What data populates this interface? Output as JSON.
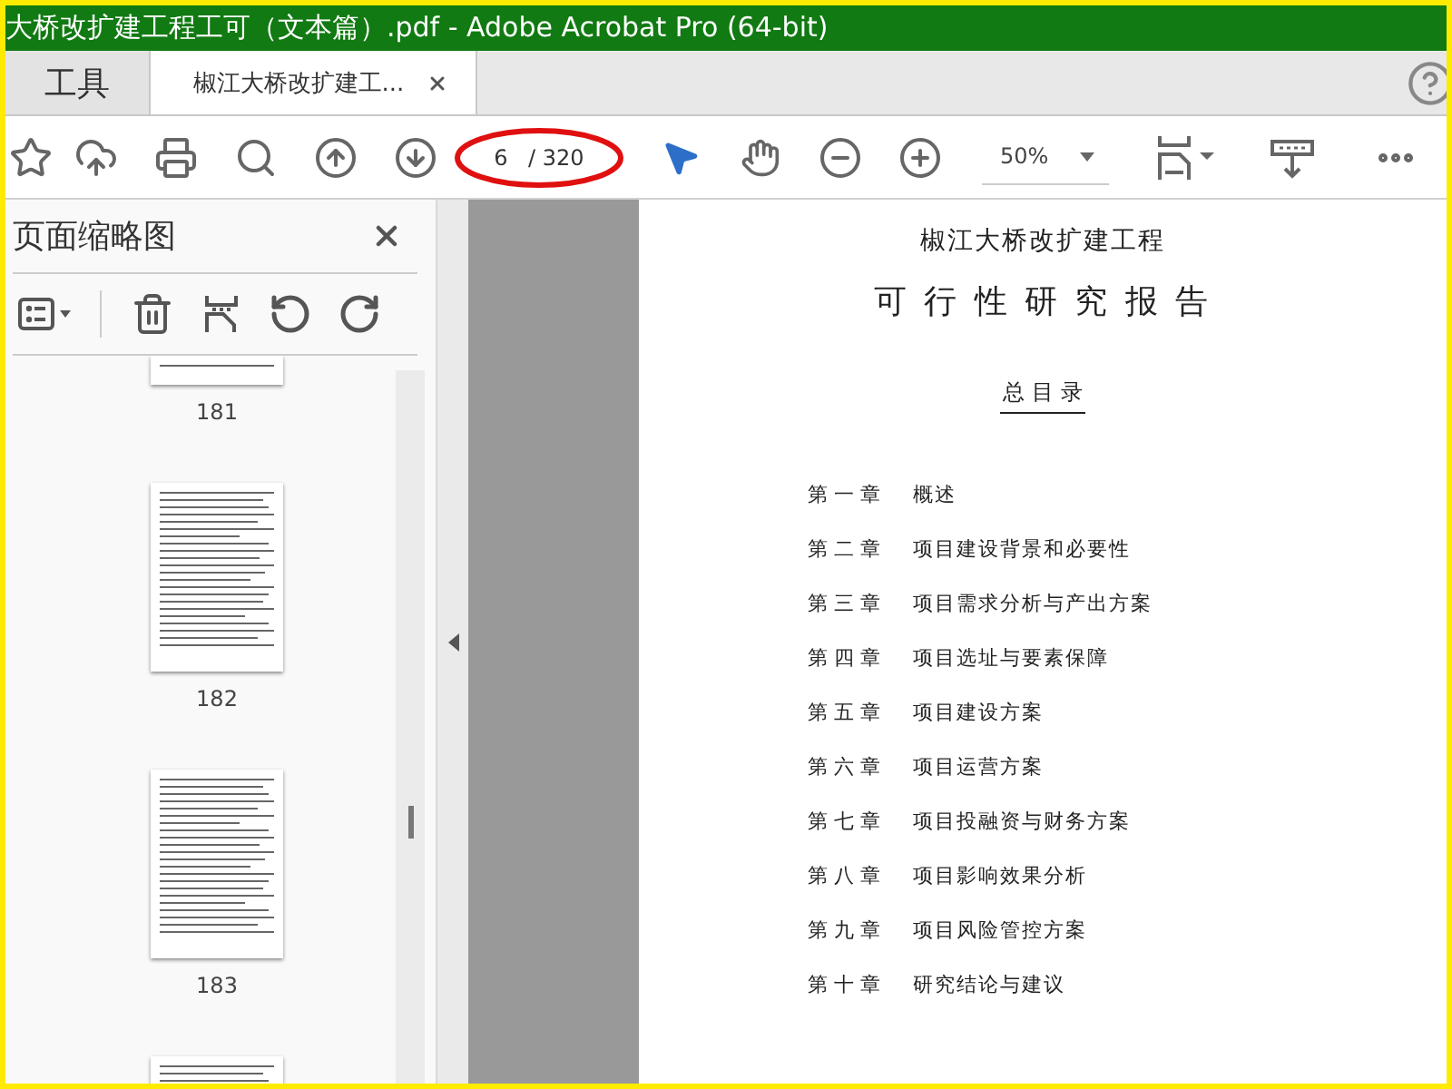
{
  "window": {
    "title": "大桥改扩建工程工可（文本篇）.pdf - Adobe Acrobat Pro (64-bit)"
  },
  "tabs": [
    {
      "label": "工具",
      "selected": false,
      "closable": false
    },
    {
      "label": "椒江大桥改扩建工...",
      "selected": true,
      "closable": true
    }
  ],
  "toolbar": {
    "page_current": "6",
    "page_total": "/ 320",
    "zoom": "50%",
    "tools": [
      {
        "kind": "select",
        "selected": true
      },
      {
        "kind": "hand",
        "selected": false
      }
    ]
  },
  "sidebar": {
    "title": "页面缩略图",
    "thumbnails": [
      {
        "kind": "cut_top",
        "label": "181"
      },
      {
        "kind": "full",
        "label": "182"
      },
      {
        "kind": "full",
        "label": "183"
      },
      {
        "kind": "cut_bottom"
      }
    ]
  },
  "document": {
    "project": "椒江大桥改扩建工程",
    "title": "可 行 性 研 究 报 告",
    "toc_title": "总 目 录",
    "toc": [
      {
        "chapter": "第 一 章",
        "title": "概述"
      },
      {
        "chapter": "第 二 章",
        "title": "项目建设背景和必要性"
      },
      {
        "chapter": "第 三 章",
        "title": "项目需求分析与产出方案"
      },
      {
        "chapter": "第 四 章",
        "title": "项目选址与要素保障"
      },
      {
        "chapter": "第 五 章",
        "title": "项目建设方案"
      },
      {
        "chapter": "第 六 章",
        "title": "项目运营方案"
      },
      {
        "chapter": "第 七 章",
        "title": "项目投融资与财务方案"
      },
      {
        "chapter": "第 八 章",
        "title": "项目影响效果分析"
      },
      {
        "chapter": "第 九 章",
        "title": "项目风险管控方案"
      },
      {
        "chapter": "第 十 章",
        "title": "研究结论与建议"
      }
    ]
  }
}
